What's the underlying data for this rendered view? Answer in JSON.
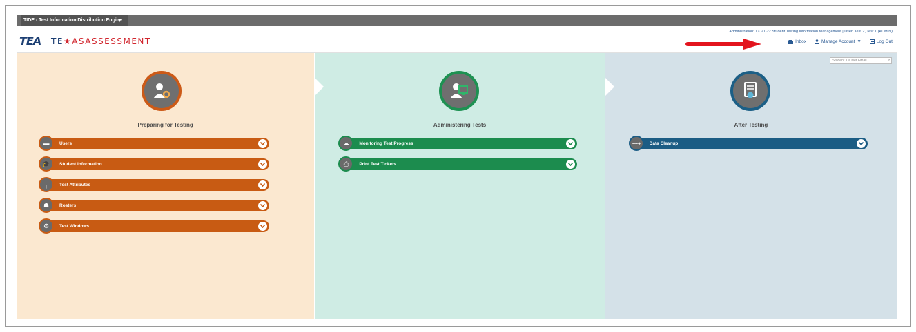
{
  "topbar": {
    "app_title": "TIDE - Test Information Distribution Engine"
  },
  "header": {
    "logo_tea": "TEA",
    "logo_te": "TE",
    "logo_star": "★",
    "logo_as": "ASASSESSMENT",
    "admin_line": "Administration: TX 21-22 Student Testing Information Management | User: Test 2, Test 1 (ADMIN)",
    "inbox": "Inbox",
    "manage_account": "Manage Account",
    "logout": "Log Out"
  },
  "search": {
    "placeholder": "Student ID/User Email"
  },
  "panels": {
    "preparing": {
      "title": "Preparing for Testing",
      "items": [
        {
          "label": "Users",
          "icon": "users-icon"
        },
        {
          "label": "Student Information",
          "icon": "graduation-cap-icon"
        },
        {
          "label": "Test Attributes",
          "icon": "attributes-icon"
        },
        {
          "label": "Rosters",
          "icon": "rosters-icon"
        },
        {
          "label": "Test Windows",
          "icon": "window-gear-icon"
        }
      ]
    },
    "administering": {
      "title": "Administering Tests",
      "items": [
        {
          "label": "Monitoring Test Progress",
          "icon": "monitor-icon"
        },
        {
          "label": "Print Test Tickets",
          "icon": "print-icon"
        }
      ]
    },
    "after": {
      "title": "After Testing",
      "items": [
        {
          "label": "Data Cleanup",
          "icon": "cleanup-icon"
        }
      ]
    }
  },
  "colors": {
    "orange": "#c85b13",
    "green": "#1c8c4e",
    "blue": "#1b5c84",
    "annotation_arrow": "#e3141d"
  }
}
